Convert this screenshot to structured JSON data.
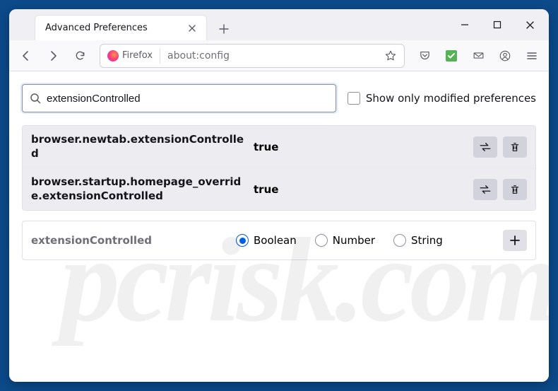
{
  "titlebar": {
    "tab_title": "Advanced Preferences"
  },
  "toolbar": {
    "identity_label": "Firefox",
    "url": "about:config"
  },
  "search": {
    "value": "extensionControlled",
    "checkbox_label": "Show only modified preferences"
  },
  "prefs": [
    {
      "name": "browser.newtab.extensionControlled",
      "value": "true"
    },
    {
      "name": "browser.startup.homepage_override.extensionControlled",
      "value": "true"
    }
  ],
  "new_pref": {
    "name": "extensionControlled",
    "types": [
      "Boolean",
      "Number",
      "String"
    ],
    "selected": "Boolean"
  },
  "watermark": "pcrisk.com"
}
